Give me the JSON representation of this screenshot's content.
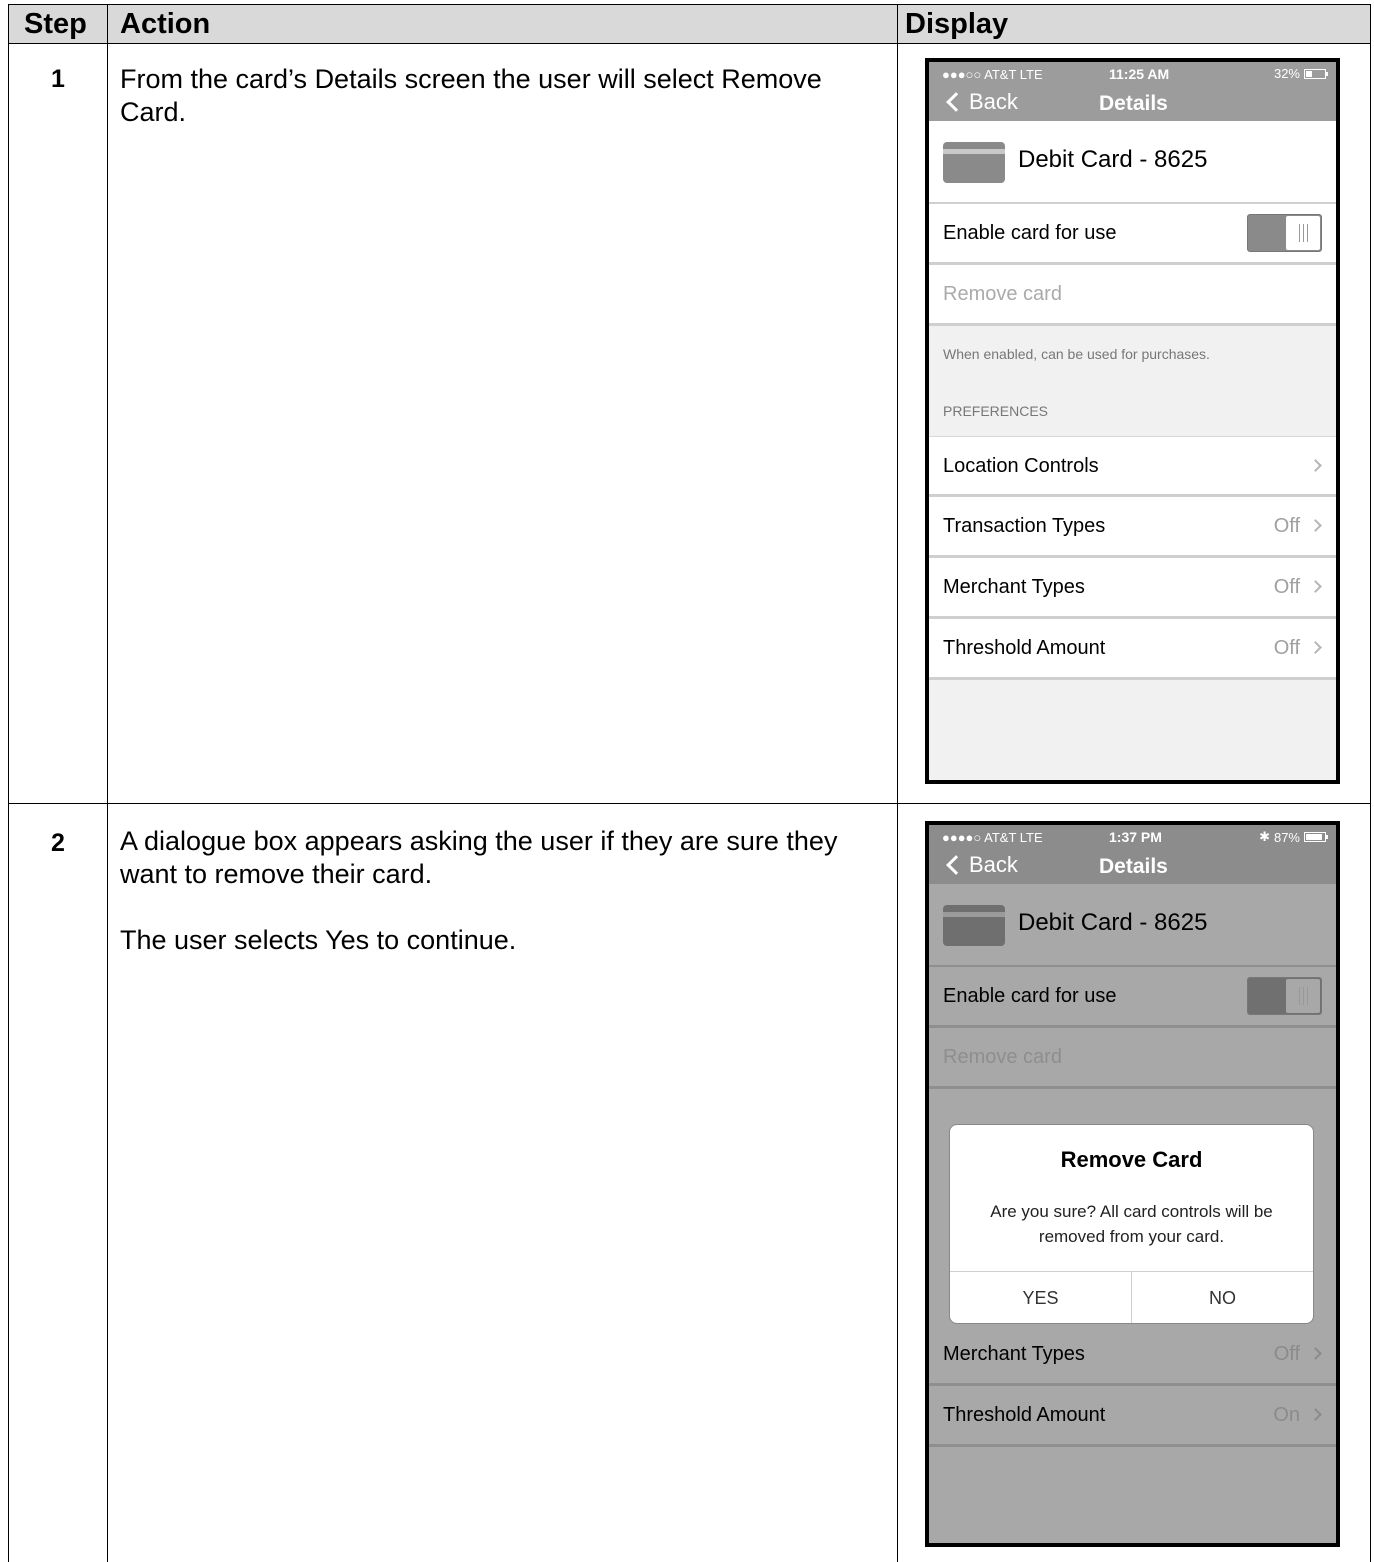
{
  "table": {
    "headers": {
      "step": "Step",
      "action": "Action",
      "display": "Display"
    }
  },
  "steps": [
    {
      "number": "1",
      "action": [
        "From the card’s Details screen the user will select Remove Card."
      ]
    },
    {
      "number": "2",
      "action": [
        "A dialogue box appears asking the user if they are sure they want to remove their card.",
        "The user selects Yes to continue."
      ]
    }
  ],
  "screens": [
    {
      "status": {
        "carrier": "●●●○○ AT&T  LTE",
        "time": "11:25 AM",
        "battery": "32%",
        "battery_level": 0.32,
        "bluetooth": ""
      },
      "nav": {
        "back": "Back",
        "title": "Details"
      },
      "card_title": "Debit Card - 8625",
      "enable_label": "Enable card for use",
      "remove_label": "Remove card",
      "footnote": "When enabled, can be used for purchases.",
      "section": "PREFERENCES",
      "prefs": [
        {
          "label": "Location Controls",
          "value": ""
        },
        {
          "label": "Transaction Types",
          "value": "Off"
        },
        {
          "label": "Merchant Types",
          "value": "Off"
        },
        {
          "label": "Threshold Amount",
          "value": "Off"
        }
      ]
    },
    {
      "status": {
        "carrier": "●●●●○ AT&T  LTE",
        "time": "1:37 PM",
        "battery": "87%",
        "battery_level": 0.87,
        "bluetooth": "✱"
      },
      "nav": {
        "back": "Back",
        "title": "Details"
      },
      "card_title": "Debit Card - 8625",
      "enable_label": "Enable card for use",
      "remove_label": "Remove card",
      "prefs": [
        {
          "label": "Merchant Types",
          "value": "Off"
        },
        {
          "label": "Threshold Amount",
          "value": "On"
        }
      ],
      "dialog": {
        "title": "Remove Card",
        "message": "Are you sure? All card controls will be removed from your card.",
        "yes": "YES",
        "no": "NO"
      }
    }
  ]
}
